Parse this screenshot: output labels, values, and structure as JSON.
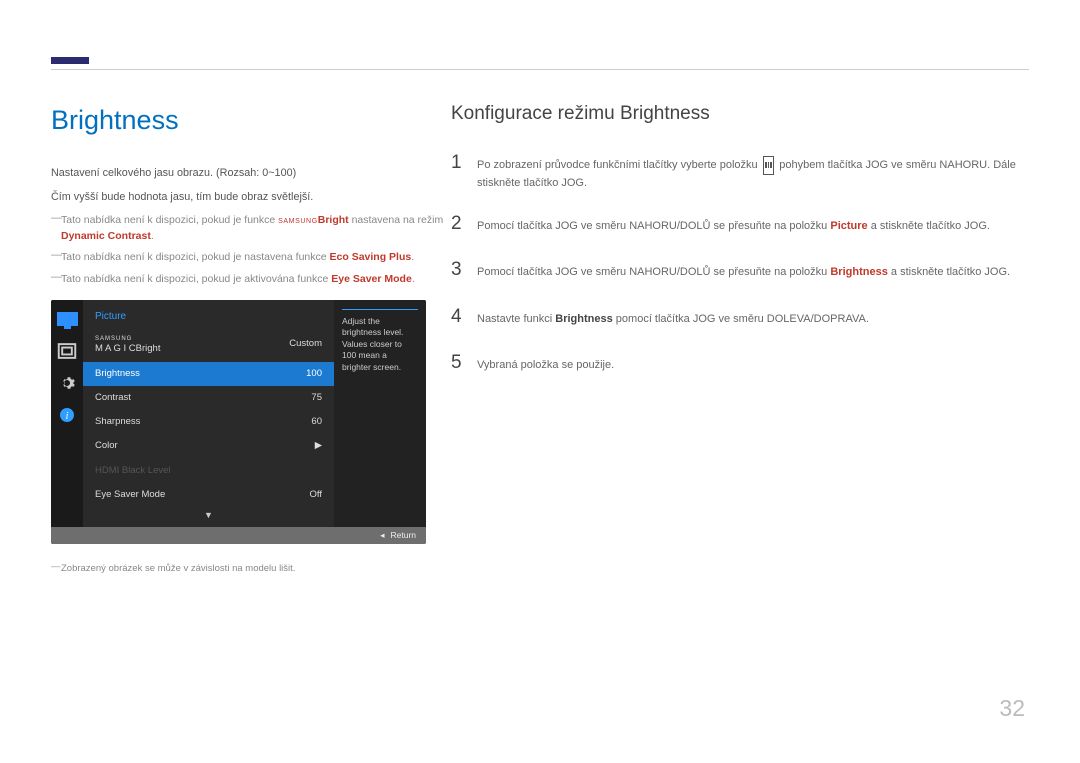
{
  "page": {
    "number": "32"
  },
  "left": {
    "heading": "Brightness",
    "p1": "Nastavení celkového jasu obrazu. (Rozsah: 0~100)",
    "p2": "Čím vyšší bude hodnota jasu, tím bude obraz světlejší.",
    "note1_pre": "Tato nabídka není k dispozici, pokud je funkce ",
    "note1_magic_prefix": "SAMSUNG",
    "note1_magic_suffix": "Bright",
    "note1_mid": " nastavena na režim ",
    "note1_red": "Dynamic Contrast",
    "note1_post": ".",
    "note2_pre": "Tato nabídka není k dispozici, pokud je nastavena funkce ",
    "note2_red": "Eco Saving Plus",
    "note2_post": ".",
    "note3_pre": "Tato nabídka není k dispozici, pokud je aktivována funkce ",
    "note3_red": "Eye Saver Mode",
    "note3_post": ".",
    "caption": "Zobrazený obrázek se může v závislosti na modelu lišit."
  },
  "right": {
    "heading": "Konfigurace režimu Brightness",
    "steps": {
      "s1_a": "Po zobrazení průvodce funkčními tlačítky vyberte položku ",
      "s1_b": " pohybem tlačítka JOG ve směru NAHORU. Dále stiskněte tlačítko JOG.",
      "s2_a": "Pomocí tlačítka JOG ve směru NAHORU/DOLŮ se přesuňte na položku ",
      "s2_red": "Picture",
      "s2_b": " a stiskněte tlačítko JOG.",
      "s3_a": "Pomocí tlačítka JOG ve směru NAHORU/DOLŮ se přesuňte na položku ",
      "s3_red": "Brightness",
      "s3_b": " a stiskněte tlačítko JOG.",
      "s4_a": "Nastavte funkci ",
      "s4_b": "Brightness",
      "s4_c": " pomocí tlačítka JOG ve směru DOLEVA/DOPRAVA.",
      "s5": "Vybraná položka se použije."
    }
  },
  "osd": {
    "title": "Picture",
    "magic_prefix": "SAMSUNG",
    "magic_brand": "M A G I C",
    "magic_suffix": "Bright",
    "magic_value": "Custom",
    "brightness_label": "Brightness",
    "brightness_value": "100",
    "contrast_label": "Contrast",
    "contrast_value": "75",
    "sharpness_label": "Sharpness",
    "sharpness_value": "60",
    "color_label": "Color",
    "color_value": "▶",
    "hdmi_label": "HDMI Black Level",
    "eyesaver_label": "Eye Saver Mode",
    "eyesaver_value": "Off",
    "tip": "Adjust the brightness level. Values closer to 100 mean a brighter screen.",
    "return": "Return"
  }
}
